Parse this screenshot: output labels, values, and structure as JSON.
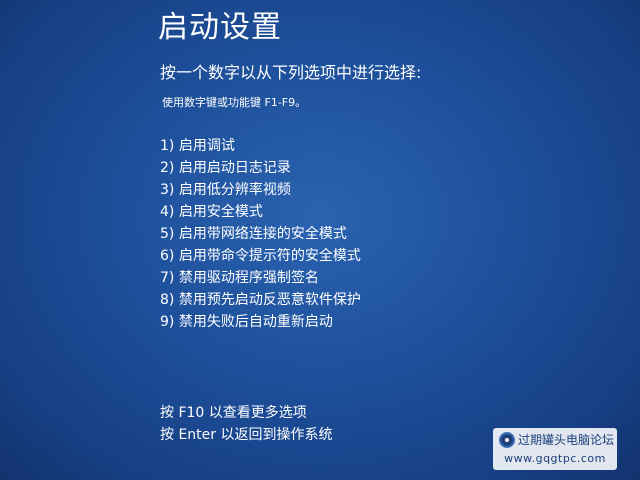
{
  "title": "启动设置",
  "prompt": "按一个数字以从下列选项中进行选择:",
  "hint": "使用数字键或功能键 F1-F9。",
  "options": [
    {
      "label": "1) 启用调试"
    },
    {
      "label": "2) 启用启动日志记录"
    },
    {
      "label": "3) 启用低分辨率视频"
    },
    {
      "label": "4) 启用安全模式"
    },
    {
      "label": "5) 启用带网络连接的安全模式"
    },
    {
      "label": "6) 启用带命令提示符的安全模式"
    },
    {
      "label": "7) 禁用驱动程序强制签名"
    },
    {
      "label": "8) 禁用预先启动反恶意软件保护"
    },
    {
      "label": "9) 禁用失败后自动重新启动"
    }
  ],
  "footer": {
    "more_options": "按 F10 以查看更多选项",
    "return_os": "按 Enter 以返回到操作系统"
  },
  "watermark": {
    "name": "过期罐头电脑论坛",
    "url": "www.gqgtpc.com"
  },
  "colors": {
    "background": "#1d4f9a",
    "text": "#ffffff"
  }
}
